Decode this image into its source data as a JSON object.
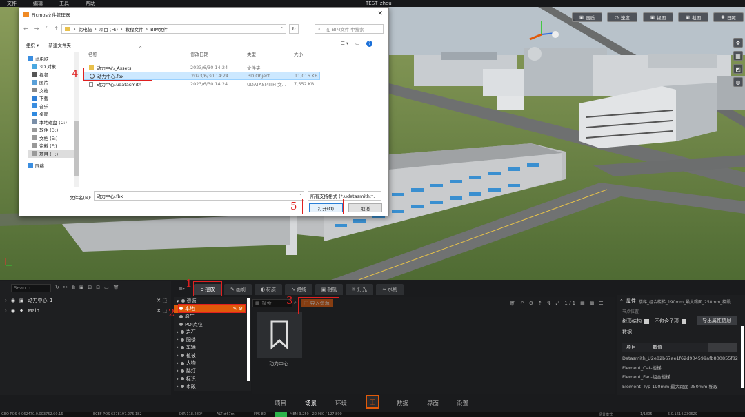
{
  "menubar": {
    "items": [
      "文件",
      "编辑",
      "工具",
      "帮助"
    ],
    "title": "TEST_zhou"
  },
  "viewport": {
    "toolbar": [
      "画质",
      "速度",
      "视图",
      "截图",
      "日照"
    ]
  },
  "dialog": {
    "title": "Picmos文件管理器",
    "path": [
      "此电脑",
      "项目 (H:)",
      "教程文件",
      "BIM文件"
    ],
    "search_placeholder": "在 BIM文件 中搜索",
    "organize": "组织 ▾",
    "new_folder": "新建文件夹",
    "columns": [
      "名称",
      "修改日期",
      "类型",
      "大小"
    ],
    "sidebar": [
      "此电脑",
      "3D 对象",
      "视频",
      "图片",
      "文档",
      "下载",
      "音乐",
      "桌面",
      "本地磁盘 (C:)",
      "软件 (D:)",
      "文档 (E:)",
      "资料 (F:)",
      "项目 (H:)",
      "网络"
    ],
    "files": [
      {
        "name": "动力中心_Assets",
        "date": "2023/6/30 14:24",
        "type": "文件夹",
        "size": ""
      },
      {
        "name": "动力中心.fbx",
        "date": "2023/6/30 14:24",
        "type": "3D Object",
        "size": "11,016 KB"
      },
      {
        "name": "动力中心.udatasmith",
        "date": "2023/6/30 14:24",
        "type": "UDATASMITH 文...",
        "size": "7,552 KB"
      }
    ],
    "filename_label": "文件名(N):",
    "filename_value": "动力中心.fbx",
    "filter": "所有支持格式 (*.udatasmith;*.",
    "open": "打开(O)",
    "cancel": "取消"
  },
  "annotations": [
    "1",
    "2",
    "3",
    "4",
    "5"
  ],
  "outliner": {
    "search_placeholder": "Search...",
    "items": [
      "动力中心_1",
      "Main"
    ]
  },
  "tabs": [
    "摆放",
    "画刷",
    "材质",
    "路线",
    "相机",
    "灯光",
    "水利"
  ],
  "categories": [
    "资源",
    "本地",
    "原生",
    "POI点位",
    "岩石",
    "配楼",
    "车辆",
    "植被",
    "人物",
    "路灯",
    "标识",
    "市政"
  ],
  "content": {
    "search_placeholder": "搜索",
    "import": "导入资源",
    "page": "1 / 1",
    "asset": "动力中心"
  },
  "properties": {
    "title": "属性",
    "subtitle": "楼梯_组合楼梯_190mm_最大踢面_250mm_梯段",
    "row1": "节点位置",
    "struct": "树形结构",
    "include_children": "不包含子项",
    "export": "导出属性信息",
    "data_label": "数据",
    "col_item": "项目",
    "col_value": "数值",
    "values": [
      "Datasmith_U2e82b67ae1f62d904599afb800855f82",
      "Element_Cat-楼梯",
      "Element_Fan-组合楼梯",
      "Element_Typ 190mm 最大踢面 250mm 梯段"
    ]
  },
  "bottom_nav": [
    "项目",
    "场景",
    "环境",
    "数据",
    "界面",
    "设置"
  ],
  "status": {
    "geo": "GEO POS  0.062470.0.003752.60.16",
    "ecef": "ECEF POS  6378197.275.182",
    "dir": "DIR  118.280°",
    "alt": "ALT  ±67m",
    "fps": "FPS  82",
    "mem": "MEM  3.250 - 22.980 / 127.890",
    "mode": "场景模式",
    "scale": "1/1805",
    "version": "5.0.1614.230629"
  },
  "colors": {
    "accent": "#e05a0a",
    "select": "#cce8ff",
    "red": "#e02020"
  }
}
